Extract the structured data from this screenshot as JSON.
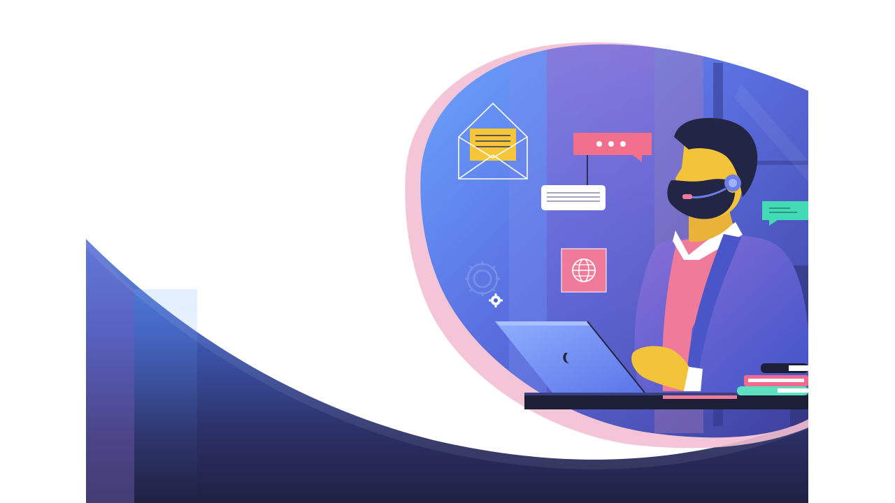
{
  "illustration": {
    "subject": "customer-support-agent-at-laptop",
    "icons": [
      "envelope-icon",
      "chat-bubble-icon",
      "message-card-icon",
      "globe-icon",
      "gear-icon",
      "small-gear-icon",
      "laptop-icon",
      "headset-icon"
    ]
  },
  "colors": {
    "background": "#ffffff",
    "wave_light": "#5a8fe6",
    "wave_dark": "#1f2142",
    "blob_top": "#6aa6ff",
    "blob_mid": "#5a6fe0",
    "blob_purple": "#8b6cc8",
    "blob_rim": "#f2bfd3",
    "skin": "#f3c43a",
    "hair": "#232544",
    "jacket": "#5b63d8",
    "shirt": "#f07a9a",
    "collar": "#ffffff",
    "desk": "#1d1f37",
    "laptop": "#7d9df5",
    "envelope_card": "#f5c53a",
    "chat_pink": "#f2708c",
    "chat_teal": "#43dbb5",
    "globe_card": "#f07a9a",
    "book_teal": "#5de0c2",
    "book_pink": "#ef6a8d",
    "book_dark": "#1d1f37"
  }
}
